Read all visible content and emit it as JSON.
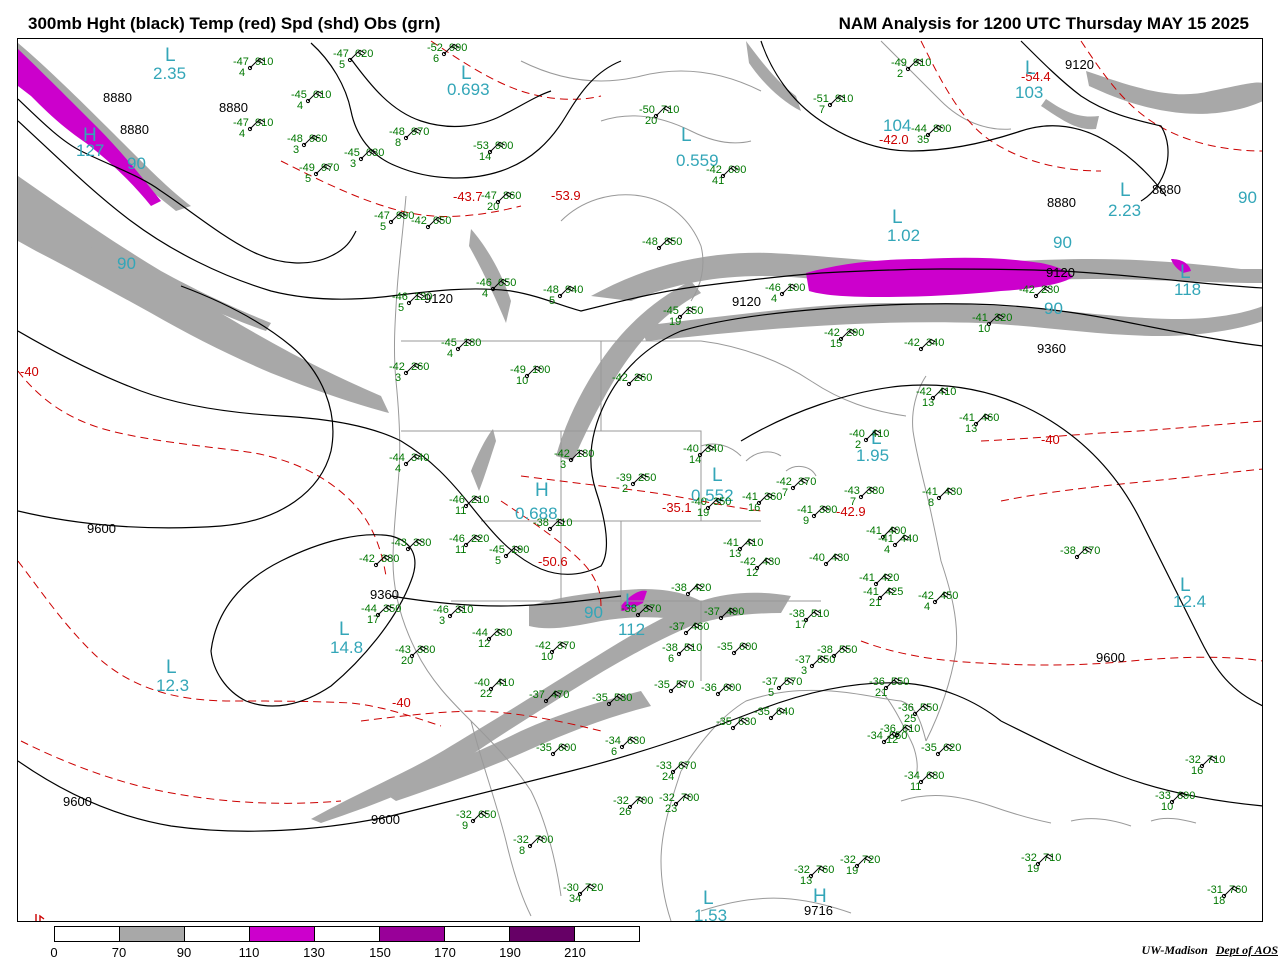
{
  "title_left": "300mb Hght (black) Temp (red) Spd (shd) Obs (grn)",
  "title_right": "NAM Analysis for 1200 UTC Thursday  MAY 15 2025",
  "credit": {
    "org": "UW-Madison",
    "dept": "Dept of AOS"
  },
  "colors": {
    "height_contour": "#000000",
    "temperature_contour": "#cc0000",
    "speed_70_90": "#a8a8a8",
    "speed_110_130": "#cc00cc",
    "speed_150_170": "#990099",
    "speed_190_210": "#660066",
    "observation": "#007700",
    "speed_label": "#33a6b8",
    "geography": "#999999"
  },
  "legend": {
    "ticks": [
      "0",
      "70",
      "90",
      "110",
      "130",
      "150",
      "170",
      "190",
      "210"
    ],
    "segments": [
      "#ffffff",
      "#a8a8a8",
      "#ffffff",
      "#cc00cc",
      "#ffffff",
      "#990099",
      "#ffffff",
      "#660066",
      "#ffffff"
    ]
  },
  "height_labels": [
    "8880",
    "8880",
    "8880",
    "8880",
    "8880",
    "9120",
    "9120",
    "9120",
    "9120",
    "9360",
    "9360",
    "9600",
    "9600",
    "9600",
    "9600",
    "9716"
  ],
  "temp_labels": [
    "-54.4",
    "-53.9",
    "-50.6",
    "-43.7",
    "-42.0",
    "-42.9",
    "-35.1",
    "-40",
    "-40",
    "-40"
  ],
  "speed_centers": [
    "2.35",
    "0.693",
    "127",
    "90",
    "90",
    "103",
    "104",
    "2.23",
    "90",
    "90",
    "118",
    "0.559",
    "1.02",
    "1.95",
    "0.552",
    "0.688",
    "90",
    "112",
    "14.8",
    "12.3",
    "12.4",
    "1.53",
    "90"
  ],
  "pressure_centers": [
    "L",
    "L",
    "H",
    "L",
    "L",
    "L",
    "L",
    "L",
    "H",
    "L",
    "L",
    "L",
    "L",
    "H",
    "L",
    "L",
    "L"
  ],
  "observations": [
    {
      "t": "-47",
      "h": "910",
      "dp": "4"
    },
    {
      "t": "-47",
      "h": "020",
      "dp": "5"
    },
    {
      "t": "-52",
      "h": "990",
      "dp": "6"
    },
    {
      "t": "-45",
      "h": "010",
      "dp": "4"
    },
    {
      "t": "-47",
      "h": "910",
      "dp": "4"
    },
    {
      "t": "-48",
      "h": "960",
      "dp": "3"
    },
    {
      "t": "-48",
      "h": "970",
      "dp": "8"
    },
    {
      "t": "-45",
      "h": "030",
      "dp": "3"
    },
    {
      "t": "-49",
      "h": "970",
      "dp": "5"
    },
    {
      "t": "-53",
      "h": "900",
      "dp": "14"
    },
    {
      "t": "-50",
      "h": "710",
      "dp": "20"
    },
    {
      "t": "-47",
      "h": "860",
      "dp": "20"
    },
    {
      "t": "-47",
      "h": "990",
      "dp": "5"
    },
    {
      "t": "-42",
      "h": "050",
      "dp": ""
    },
    {
      "t": "-48",
      "h": "850",
      "dp": ""
    },
    {
      "t": "-46",
      "h": "050",
      "dp": "4"
    },
    {
      "t": "-48",
      "h": "940",
      "dp": "5"
    },
    {
      "t": "-46",
      "h": "120",
      "dp": "5"
    },
    {
      "t": "-45",
      "h": "180",
      "dp": "4"
    },
    {
      "t": "-42",
      "h": "260",
      "dp": "3"
    },
    {
      "t": "-49",
      "h": "100",
      "dp": "10"
    },
    {
      "t": "-42",
      "h": "260",
      "dp": ""
    },
    {
      "t": "-44",
      "h": "340",
      "dp": "4"
    },
    {
      "t": "-42",
      "h": "180",
      "dp": "3"
    },
    {
      "t": "-40",
      "h": "340",
      "dp": "14"
    },
    {
      "t": "-39",
      "h": "250",
      "dp": "2"
    },
    {
      "t": "-46",
      "h": "210",
      "dp": "11"
    },
    {
      "t": "-40",
      "h": "350",
      "dp": "19"
    },
    {
      "t": "-41",
      "h": "360",
      "dp": "16"
    },
    {
      "t": "-42",
      "h": "370",
      "dp": "7"
    },
    {
      "t": "-38",
      "h": "110",
      "dp": ""
    },
    {
      "t": "-43",
      "h": "330",
      "dp": ""
    },
    {
      "t": "-46",
      "h": "220",
      "dp": "11"
    },
    {
      "t": "-45",
      "h": "190",
      "dp": "5"
    },
    {
      "t": "-42",
      "h": "380",
      "dp": ""
    },
    {
      "t": "-41",
      "h": "410",
      "dp": "13"
    },
    {
      "t": "-42",
      "h": "430",
      "dp": "12"
    },
    {
      "t": "-41",
      "h": "390",
      "dp": "9"
    },
    {
      "t": "-43",
      "h": "380",
      "dp": "7"
    },
    {
      "t": "-44",
      "h": "350",
      "dp": "17"
    },
    {
      "t": "-46",
      "h": "310",
      "dp": "3"
    },
    {
      "t": "-44",
      "h": "330",
      "dp": "12"
    },
    {
      "t": "-42",
      "h": "370",
      "dp": "10"
    },
    {
      "t": "-38",
      "h": "420",
      "dp": ""
    },
    {
      "t": "-38",
      "h": "370",
      "dp": ""
    },
    {
      "t": "-37",
      "h": "460",
      "dp": ""
    },
    {
      "t": "-37",
      "h": "490",
      "dp": ""
    },
    {
      "t": "-38",
      "h": "510",
      "dp": "6"
    },
    {
      "t": "-38",
      "h": "510",
      "dp": "17"
    },
    {
      "t": "-40",
      "h": "430",
      "dp": ""
    },
    {
      "t": "-41",
      "h": "400",
      "dp": ""
    },
    {
      "t": "-41",
      "h": "420",
      "dp": ""
    },
    {
      "t": "-41",
      "h": "425",
      "dp": "21"
    },
    {
      "t": "-42",
      "h": "450",
      "dp": "4"
    },
    {
      "t": "-41",
      "h": "440",
      "dp": "4"
    },
    {
      "t": "-43",
      "h": "380",
      "dp": "20"
    },
    {
      "t": "-40",
      "h": "410",
      "dp": "22"
    },
    {
      "t": "-37",
      "h": "470",
      "dp": ""
    },
    {
      "t": "-35",
      "h": "530",
      "dp": ""
    },
    {
      "t": "-35",
      "h": "570",
      "dp": ""
    },
    {
      "t": "-35",
      "h": "600",
      "dp": ""
    },
    {
      "t": "-37",
      "h": "550",
      "dp": "3"
    },
    {
      "t": "-37",
      "h": "570",
      "dp": "5"
    },
    {
      "t": "-36",
      "h": "600",
      "dp": ""
    },
    {
      "t": "-38",
      "h": "550",
      "dp": ""
    },
    {
      "t": "-36",
      "h": "550",
      "dp": "21"
    },
    {
      "t": "-35",
      "h": "640",
      "dp": ""
    },
    {
      "t": "-35",
      "h": "630",
      "dp": ""
    },
    {
      "t": "-36",
      "h": "550",
      "dp": "25"
    },
    {
      "t": "-36",
      "h": "610",
      "dp": "12"
    },
    {
      "t": "-35",
      "h": "620",
      "dp": ""
    },
    {
      "t": "-34",
      "h": "680",
      "dp": "11"
    },
    {
      "t": "-34",
      "h": "550",
      "dp": ""
    },
    {
      "t": "-35",
      "h": "600",
      "dp": ""
    },
    {
      "t": "-34",
      "h": "630",
      "dp": "6"
    },
    {
      "t": "-33",
      "h": "670",
      "dp": "24"
    },
    {
      "t": "-32",
      "h": "700",
      "dp": "26"
    },
    {
      "t": "-32",
      "h": "700",
      "dp": "23"
    },
    {
      "t": "-32",
      "h": "650",
      "dp": "9"
    },
    {
      "t": "-32",
      "h": "700",
      "dp": "8"
    },
    {
      "t": "-30",
      "h": "720",
      "dp": "34"
    },
    {
      "t": "-32",
      "h": "760",
      "dp": "13"
    },
    {
      "t": "-32",
      "h": "720",
      "dp": "19"
    },
    {
      "t": "-32",
      "h": "710",
      "dp": "19"
    },
    {
      "t": "-32",
      "h": "710",
      "dp": "16"
    },
    {
      "t": "-33",
      "h": "690",
      "dp": "10"
    },
    {
      "t": "-31",
      "h": "760",
      "dp": "18"
    },
    {
      "t": "-38",
      "h": "570",
      "dp": ""
    },
    {
      "t": "-42",
      "h": "410",
      "dp": "13"
    },
    {
      "t": "-41",
      "h": "460",
      "dp": "13"
    },
    {
      "t": "-42",
      "h": "340",
      "dp": ""
    },
    {
      "t": "-42",
      "h": "290",
      "dp": "15"
    },
    {
      "t": "-41",
      "h": "320",
      "dp": "10"
    },
    {
      "t": "-42",
      "h": "230",
      "dp": ""
    },
    {
      "t": "-46",
      "h": "100",
      "dp": "4"
    },
    {
      "t": "-45",
      "h": "150",
      "dp": "19"
    },
    {
      "t": "-44",
      "h": "800",
      "dp": "35"
    },
    {
      "t": "-49",
      "h": "910",
      "dp": "2"
    },
    {
      "t": "-51",
      "h": "910",
      "dp": "7"
    },
    {
      "t": "-42",
      "h": "690",
      "dp": "41"
    },
    {
      "t": "-40",
      "h": "410",
      "dp": "2"
    },
    {
      "t": "-41",
      "h": "430",
      "dp": "8"
    }
  ]
}
